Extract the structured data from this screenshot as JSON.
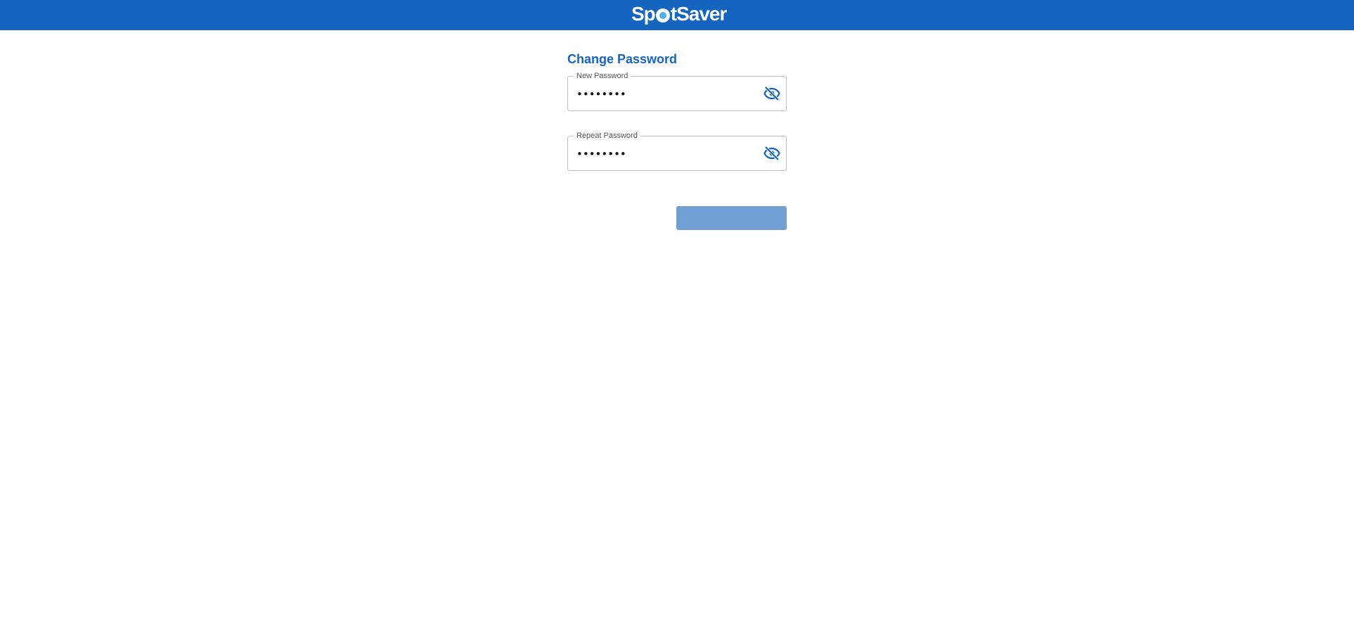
{
  "brand": {
    "name_before": "Sp",
    "name_after": "tSaver",
    "bar_color": "#1565c0",
    "logo_accent": "#4fb0e8"
  },
  "page": {
    "title": "Change Password"
  },
  "form": {
    "new_password": {
      "label": "New Password",
      "value": "••••••••",
      "toggle_icon": "eye-off-icon"
    },
    "repeat_password": {
      "label": "Repeat Password",
      "value": "••••••••",
      "toggle_icon": "eye-off-icon"
    },
    "submit": {
      "label": "",
      "state": "disabled",
      "color": "#729fd3"
    }
  }
}
